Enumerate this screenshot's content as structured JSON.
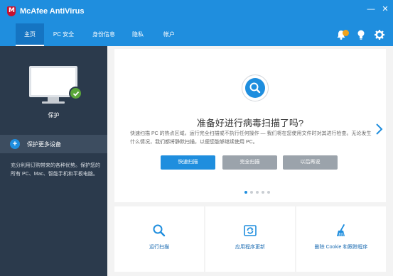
{
  "app": {
    "title": "McAfee AntiVirus"
  },
  "window": {
    "minimize": "—",
    "close": "✕"
  },
  "nav": {
    "tabs": [
      {
        "label": "主页",
        "active": true
      },
      {
        "label": "PC 安全",
        "active": false
      },
      {
        "label": "身份信息",
        "active": false
      },
      {
        "label": "隐私",
        "active": false
      },
      {
        "label": "帐户",
        "active": false
      }
    ],
    "icons": [
      "bell-icon",
      "lightbulb-icon",
      "gear-icon"
    ]
  },
  "left": {
    "status_label": "保护",
    "protect_more_label": "保护更多设备",
    "blurb": "充分利用订购带来的各种优势。保护您的所有 PC、Mac、智能手机和平板电脑。"
  },
  "hero": {
    "headline": "准备好进行病毒扫描了吗?",
    "description": "快速扫描 PC 的热点区域，运行完全扫描或不执行任何操作 — 我们将在您使用文件时对其进行检查。无论发生什么情况，我们都将静默扫描，以便您能够继续使用 PC。",
    "buttons": {
      "quick_scan": "快速扫描",
      "full_scan": "完全扫描",
      "later": "以后再说"
    },
    "pagination": {
      "count": 5,
      "active_index": 0
    }
  },
  "tiles": [
    {
      "label": "运行扫描",
      "icon": "search-icon"
    },
    {
      "label": "应用程序更新",
      "icon": "refresh-icon"
    },
    {
      "label": "删除 Cookie 和跟踪程序",
      "icon": "broom-icon"
    }
  ],
  "colors": {
    "accent": "#1f8ede",
    "sidebar": "#2b3a4c",
    "success": "#5aa63a",
    "badge": "#f2a31b"
  }
}
